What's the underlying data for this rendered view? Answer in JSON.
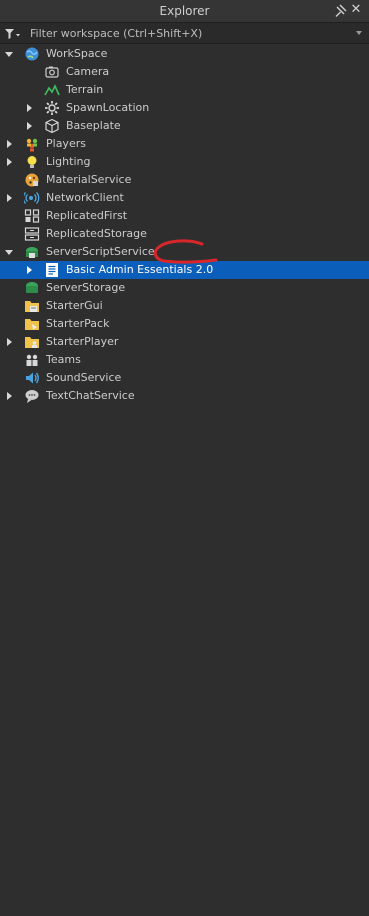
{
  "panel": {
    "title": "Explorer"
  },
  "filter": {
    "placeholder": "Filter workspace (Ctrl+Shift+X)"
  },
  "tree": [
    {
      "label": "WorkSpace",
      "icon": "workspace-icon",
      "depth": 0,
      "expander": "expanded"
    },
    {
      "label": "Camera",
      "icon": "camera-icon",
      "depth": 1,
      "expander": "none"
    },
    {
      "label": "Terrain",
      "icon": "terrain-icon",
      "depth": 1,
      "expander": "none"
    },
    {
      "label": "SpawnLocation",
      "icon": "spawn-location-icon",
      "depth": 1,
      "expander": "collapsed"
    },
    {
      "label": "Baseplate",
      "icon": "part-icon",
      "depth": 1,
      "expander": "collapsed"
    },
    {
      "label": "Players",
      "icon": "players-icon",
      "depth": 0,
      "expander": "collapsed"
    },
    {
      "label": "Lighting",
      "icon": "lighting-icon",
      "depth": 0,
      "expander": "collapsed"
    },
    {
      "label": "MaterialService",
      "icon": "material-service-icon",
      "depth": 0,
      "expander": "none"
    },
    {
      "label": "NetworkClient",
      "icon": "network-client-icon",
      "depth": 0,
      "expander": "collapsed"
    },
    {
      "label": "ReplicatedFirst",
      "icon": "replicated-first-icon",
      "depth": 0,
      "expander": "none"
    },
    {
      "label": "ReplicatedStorage",
      "icon": "replicated-storage-icon",
      "depth": 0,
      "expander": "none"
    },
    {
      "label": "ServerScriptService",
      "icon": "server-script-service-icon",
      "depth": 0,
      "expander": "expanded"
    },
    {
      "label": "Basic Admin Essentials 2.0",
      "icon": "script-icon",
      "depth": 1,
      "expander": "collapsed",
      "selected": true
    },
    {
      "label": "ServerStorage",
      "icon": "server-storage-icon",
      "depth": 0,
      "expander": "none"
    },
    {
      "label": "StarterGui",
      "icon": "starter-gui-icon",
      "depth": 0,
      "expander": "none"
    },
    {
      "label": "StarterPack",
      "icon": "starter-pack-icon",
      "depth": 0,
      "expander": "none"
    },
    {
      "label": "StarterPlayer",
      "icon": "starter-player-icon",
      "depth": 0,
      "expander": "collapsed"
    },
    {
      "label": "Teams",
      "icon": "teams-icon",
      "depth": 0,
      "expander": "none"
    },
    {
      "label": "SoundService",
      "icon": "sound-service-icon",
      "depth": 0,
      "expander": "none"
    },
    {
      "label": "TextChatService",
      "icon": "text-chat-service-icon",
      "depth": 0,
      "expander": "collapsed"
    }
  ],
  "colors": {
    "background": "#2e2e2e",
    "selection": "#0b5fba",
    "annotation": "#d9262b"
  }
}
